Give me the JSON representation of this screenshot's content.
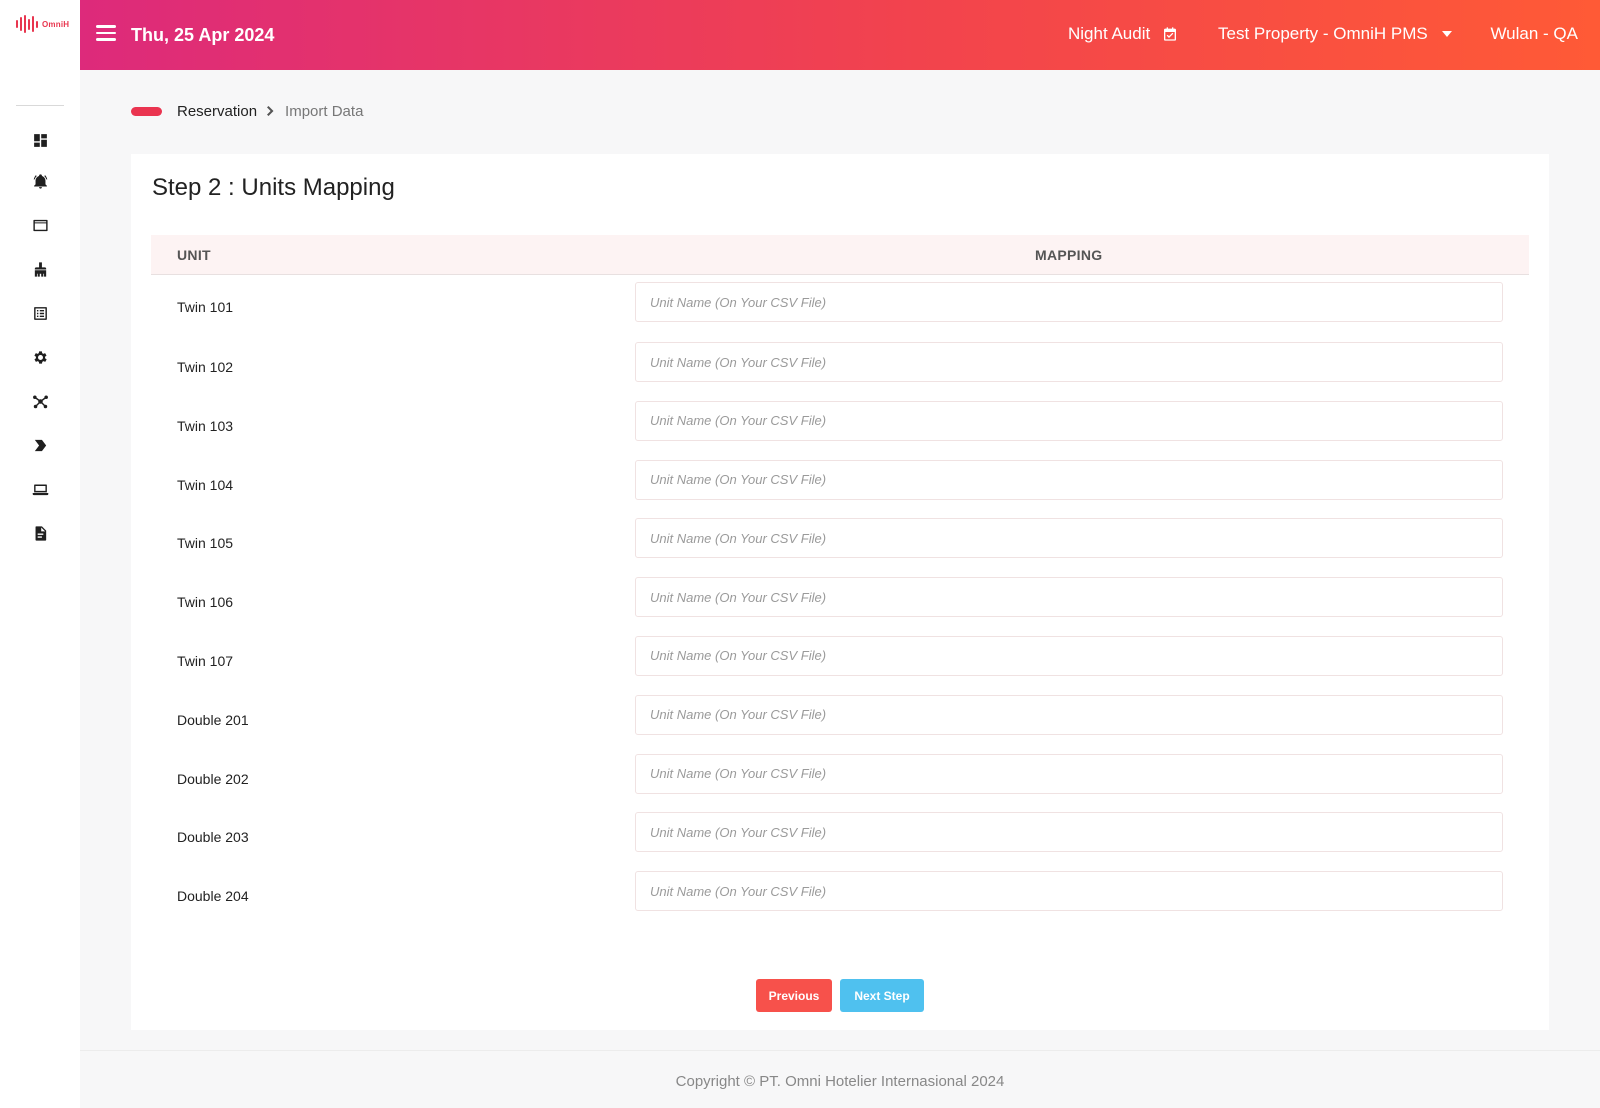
{
  "app": {
    "logo_text": "OmniH"
  },
  "header": {
    "date": "Thu, 25 Apr 2024",
    "night_audit_label": "Night Audit",
    "property_label": "Test Property - OmniH PMS",
    "user_label": "Wulan - QA"
  },
  "sidebar": {
    "icons": [
      "dashboard-icon",
      "concierge-bell-icon",
      "window-icon",
      "cleaning-icon",
      "list-icon",
      "gear-icon",
      "network-icon",
      "chevron-tag-icon",
      "laptop-icon",
      "document-icon"
    ]
  },
  "breadcrumb": {
    "parent": "Reservation",
    "current": "Import Data"
  },
  "page": {
    "title": "Step 2 : Units Mapping",
    "columns": {
      "unit": "UNIT",
      "mapping": "MAPPING"
    },
    "placeholder": "Unit Name (On Your CSV File)",
    "units": [
      "Twin 101",
      "Twin 102",
      "Twin 103",
      "Twin 104",
      "Twin 105",
      "Twin 106",
      "Twin 107",
      "Double 201",
      "Double 202",
      "Double 203",
      "Double 204"
    ],
    "previous_label": "Previous",
    "next_label": "Next Step"
  },
  "footer": {
    "copyright": "Copyright © PT. Omni Hotelier Internasional 2024"
  },
  "colors": {
    "accent": "#ea3450",
    "previous": "#f7514b",
    "next": "#4fc1ef",
    "header_start": "#dd2a7b",
    "header_end": "#ff5a36"
  }
}
